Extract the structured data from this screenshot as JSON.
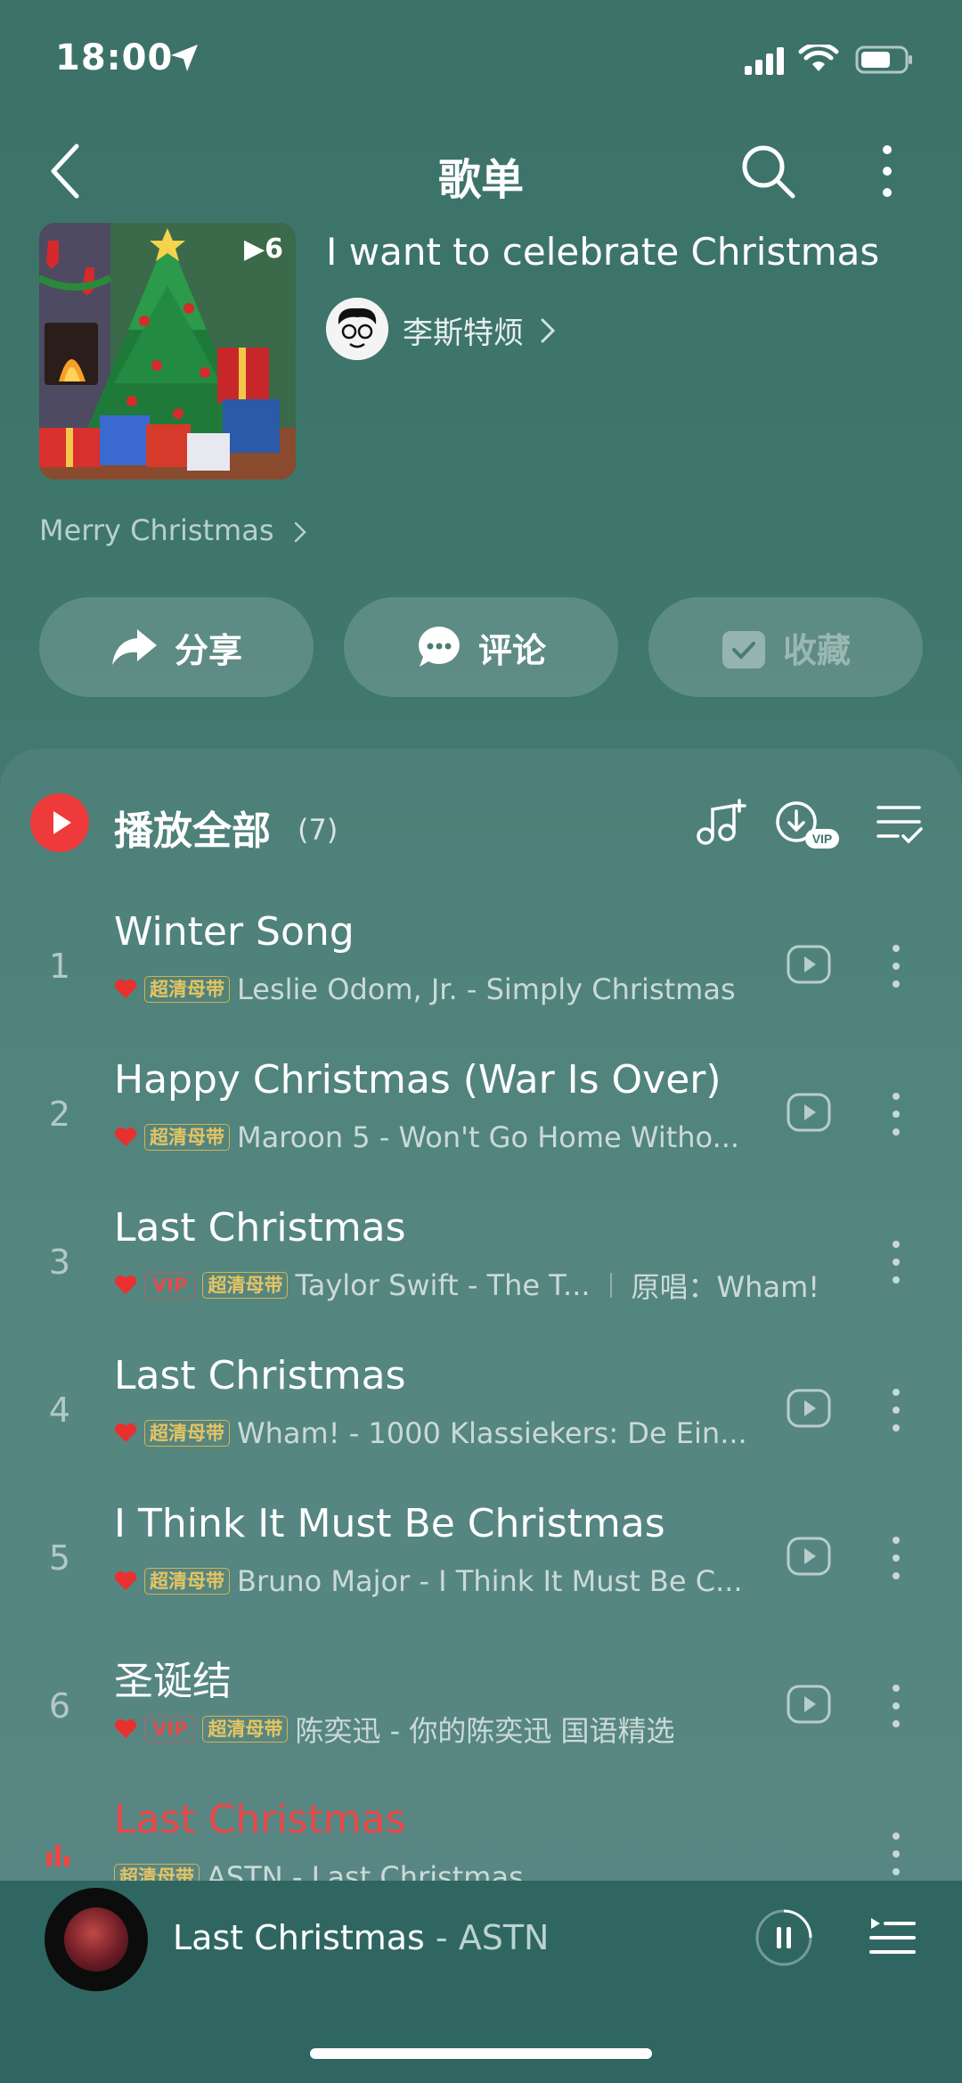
{
  "status_bar": {
    "time": "18:00"
  },
  "header": {
    "title": "歌单"
  },
  "playlist": {
    "name": "I want to celebrate Christmas",
    "play_count": "6",
    "creator": "李斯特烦",
    "description": "Merry Christmas"
  },
  "actions": {
    "share": "分享",
    "comment": "评论",
    "collect": "收藏"
  },
  "list_header": {
    "play_all": "播放全部",
    "count": "(7)"
  },
  "songs": [
    {
      "num": "1",
      "title": "Winter Song",
      "vip": "",
      "quality": "超清母带",
      "subtitle": "Leslie Odom, Jr. - Simply Christmas",
      "original": ""
    },
    {
      "num": "2",
      "title": "Happy Christmas (War Is Over)",
      "vip": "",
      "quality": "超清母带",
      "subtitle": "Maroon 5 - Won't Go Home Witho...",
      "original": ""
    },
    {
      "num": "3",
      "title": "Last Christmas",
      "vip": "VIP",
      "quality": "超清母带",
      "subtitle": "Taylor Swift - The T...",
      "original": "原唱：Wham!"
    },
    {
      "num": "4",
      "title": "Last Christmas",
      "vip": "",
      "quality": "超清母带",
      "subtitle": "Wham! - 1000 Klassiekers: De Ein...",
      "original": ""
    },
    {
      "num": "5",
      "title": "I Think It Must Be Christmas",
      "vip": "",
      "quality": "超清母带",
      "subtitle": "Bruno Major - I Think It Must Be C...",
      "original": ""
    },
    {
      "num": "6",
      "title": "圣诞结",
      "vip": "VIP",
      "quality": "超清母带",
      "subtitle": "陈奕迅 - 你的陈奕迅 国语精选",
      "original": ""
    },
    {
      "num": "",
      "title": "Last Christmas",
      "vip": "",
      "quality": "超清母带",
      "subtitle": "ASTN - Last Christmas",
      "original": ""
    }
  ],
  "now_playing": {
    "title": "Last Christmas",
    "separator": " - ",
    "artist": "ASTN"
  },
  "colors": {
    "accent_red": "#ee3a3a",
    "quality_gold": "#e6c462",
    "background": "#3f776d"
  }
}
